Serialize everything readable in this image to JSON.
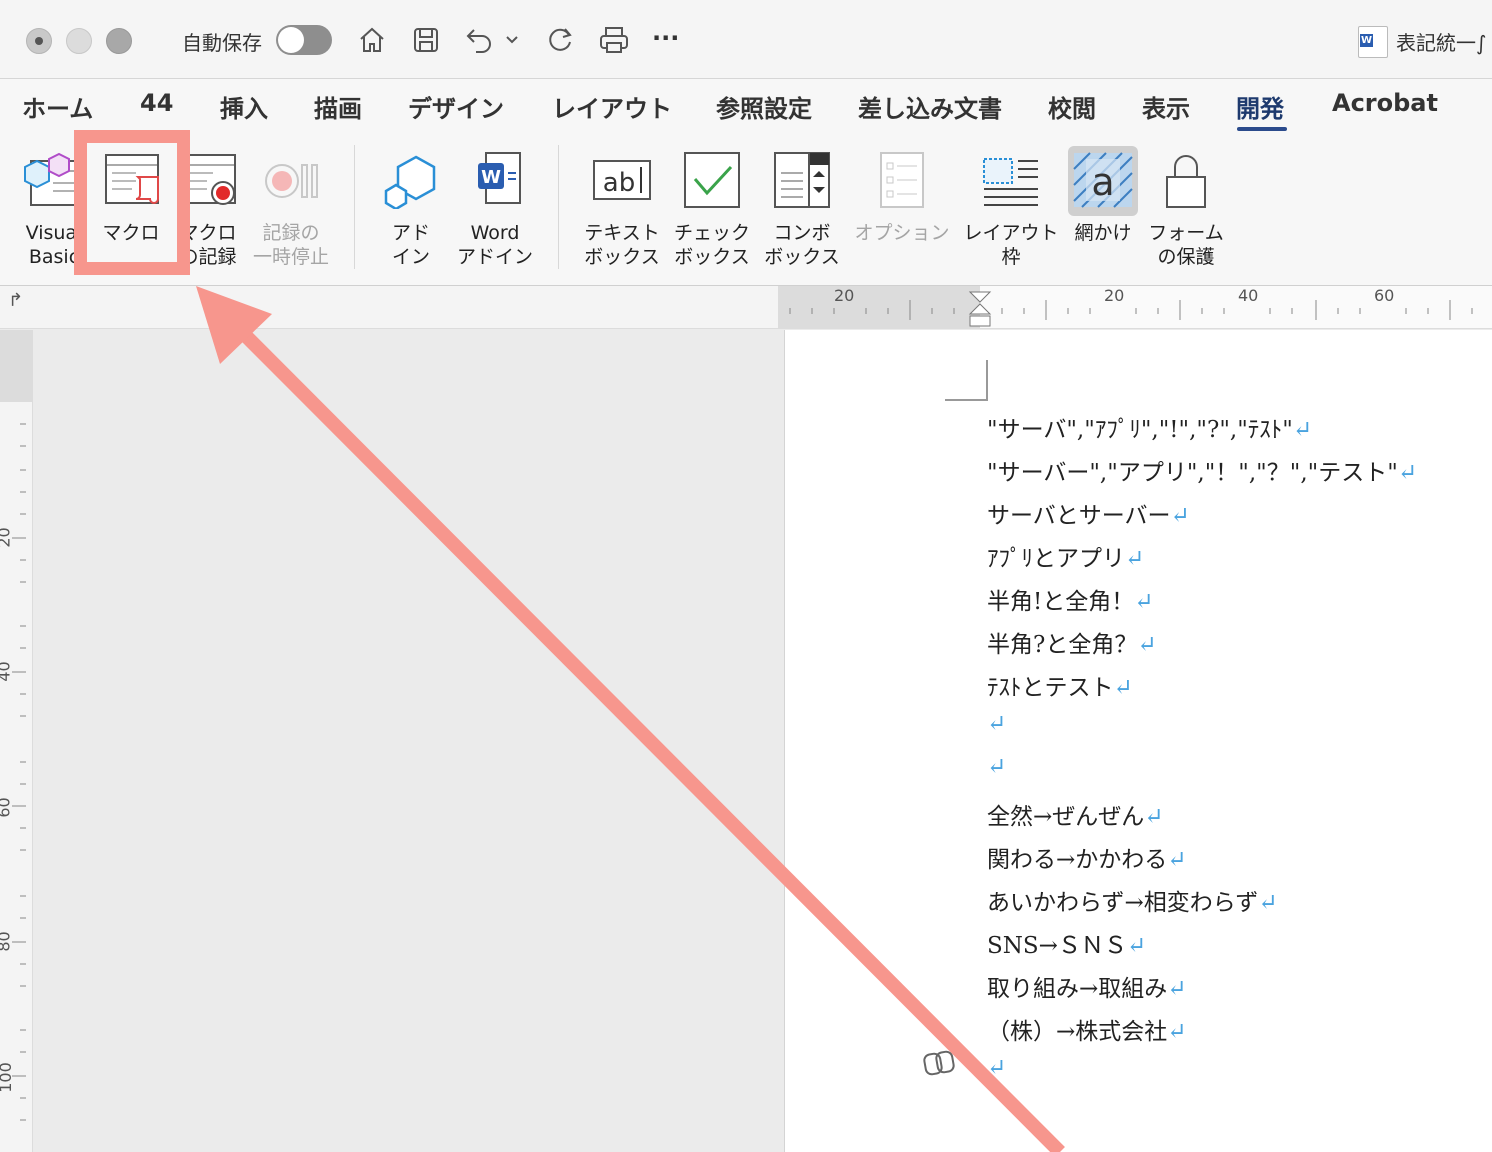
{
  "titlebar": {
    "autosave_label": "自動保存",
    "doc_title": "表記統一∫",
    "more_label": "···"
  },
  "tabs": [
    {
      "label": "ホーム"
    },
    {
      "label": "44"
    },
    {
      "label": "挿入"
    },
    {
      "label": "描画"
    },
    {
      "label": "デザイン"
    },
    {
      "label": "レイアウト"
    },
    {
      "label": "参照設定"
    },
    {
      "label": "差し込み文書"
    },
    {
      "label": "校閲"
    },
    {
      "label": "表示"
    },
    {
      "label": "開発"
    },
    {
      "label": "Acrobat"
    }
  ],
  "active_tab": "開発",
  "ribbon": {
    "visual_basic": "Visual\nBasic",
    "macro": "マクロ",
    "record_macro": "マクロ\nの記録",
    "pause_recording": "記録の\n一時停止",
    "addins": "アド\nイン",
    "word_addins": "Word\nアドイン",
    "text_box": "テキスト\nボックス",
    "check_box": "チェック\nボックス",
    "combo_box": "コンボ\nボックス",
    "options": "オプション",
    "layout_frame": "レイアウト\n枠",
    "shading": "網かけ",
    "protect_form": "フォーム\nの保護"
  },
  "ruler": {
    "h_labels": [
      "20",
      "20",
      "40",
      "60"
    ],
    "v_labels": [
      "20",
      "40",
      "60",
      "80",
      "100"
    ]
  },
  "document": {
    "lines": [
      "\"サーバ\",\"ｱﾌﾟﾘ\",\"!\",\"?\",\"ﾃｽﾄ\"",
      "\"サーバー\",\"アプリ\",\"！\",\"？\",\"テスト\"",
      "サーバとサーバー",
      "ｱﾌﾟﾘとアプリ",
      "半角!と全角！",
      "半角?と全角？",
      "ﾃｽﾄとテスト",
      "",
      "",
      "全然→ぜんぜん",
      "関わる→かかわる",
      "あいかわらず→相変わらず",
      "SNS→ＳＮＳ",
      "取り組み→取組み",
      "（株）→株式会社",
      ""
    ],
    "paragraph_mark": "↵"
  },
  "colors": {
    "annotation": "#f7968d",
    "active_tab_underline": "#2b4b8c",
    "paragraph_mark": "#4aa3df"
  }
}
